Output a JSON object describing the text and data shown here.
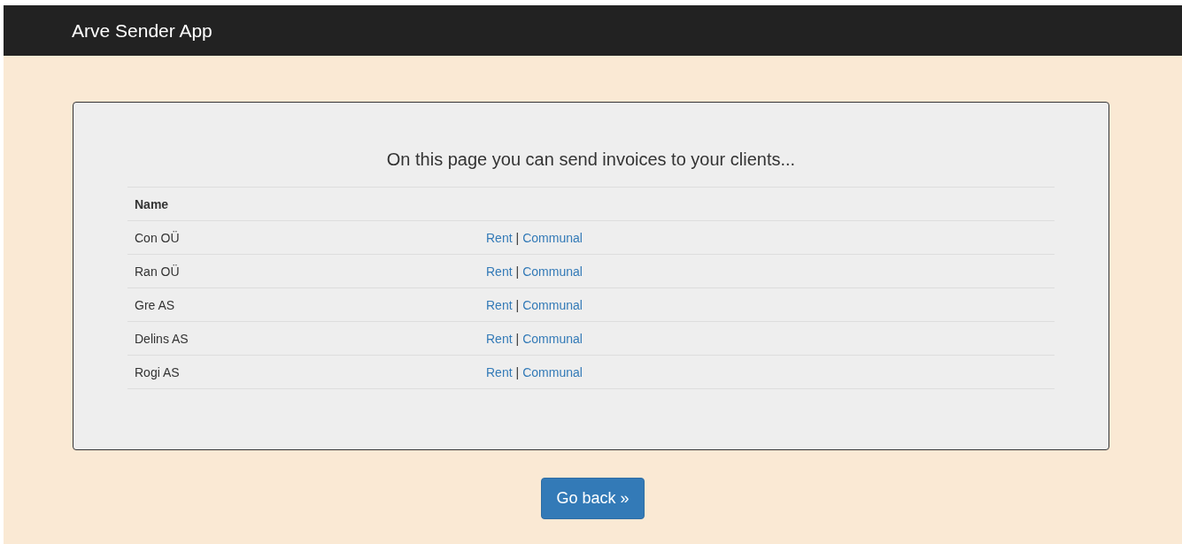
{
  "navbar": {
    "brand": "Arve Sender App"
  },
  "panel": {
    "heading": "On this page you can send invoices to your clients...",
    "table": {
      "columns": [
        "Name"
      ],
      "rows": [
        {
          "name": "Con OÜ",
          "links": [
            "Rent",
            "Communal"
          ],
          "separator": "|"
        },
        {
          "name": "Ran OÜ",
          "links": [
            "Rent",
            "Communal"
          ],
          "separator": "|"
        },
        {
          "name": "Gre AS",
          "links": [
            "Rent",
            "Communal"
          ],
          "separator": "|"
        },
        {
          "name": "Delins AS",
          "links": [
            "Rent",
            "Communal"
          ],
          "separator": "|"
        },
        {
          "name": "Rogi AS",
          "links": [
            "Rent",
            "Communal"
          ],
          "separator": "|"
        }
      ]
    }
  },
  "button": {
    "label": "Go back »"
  }
}
